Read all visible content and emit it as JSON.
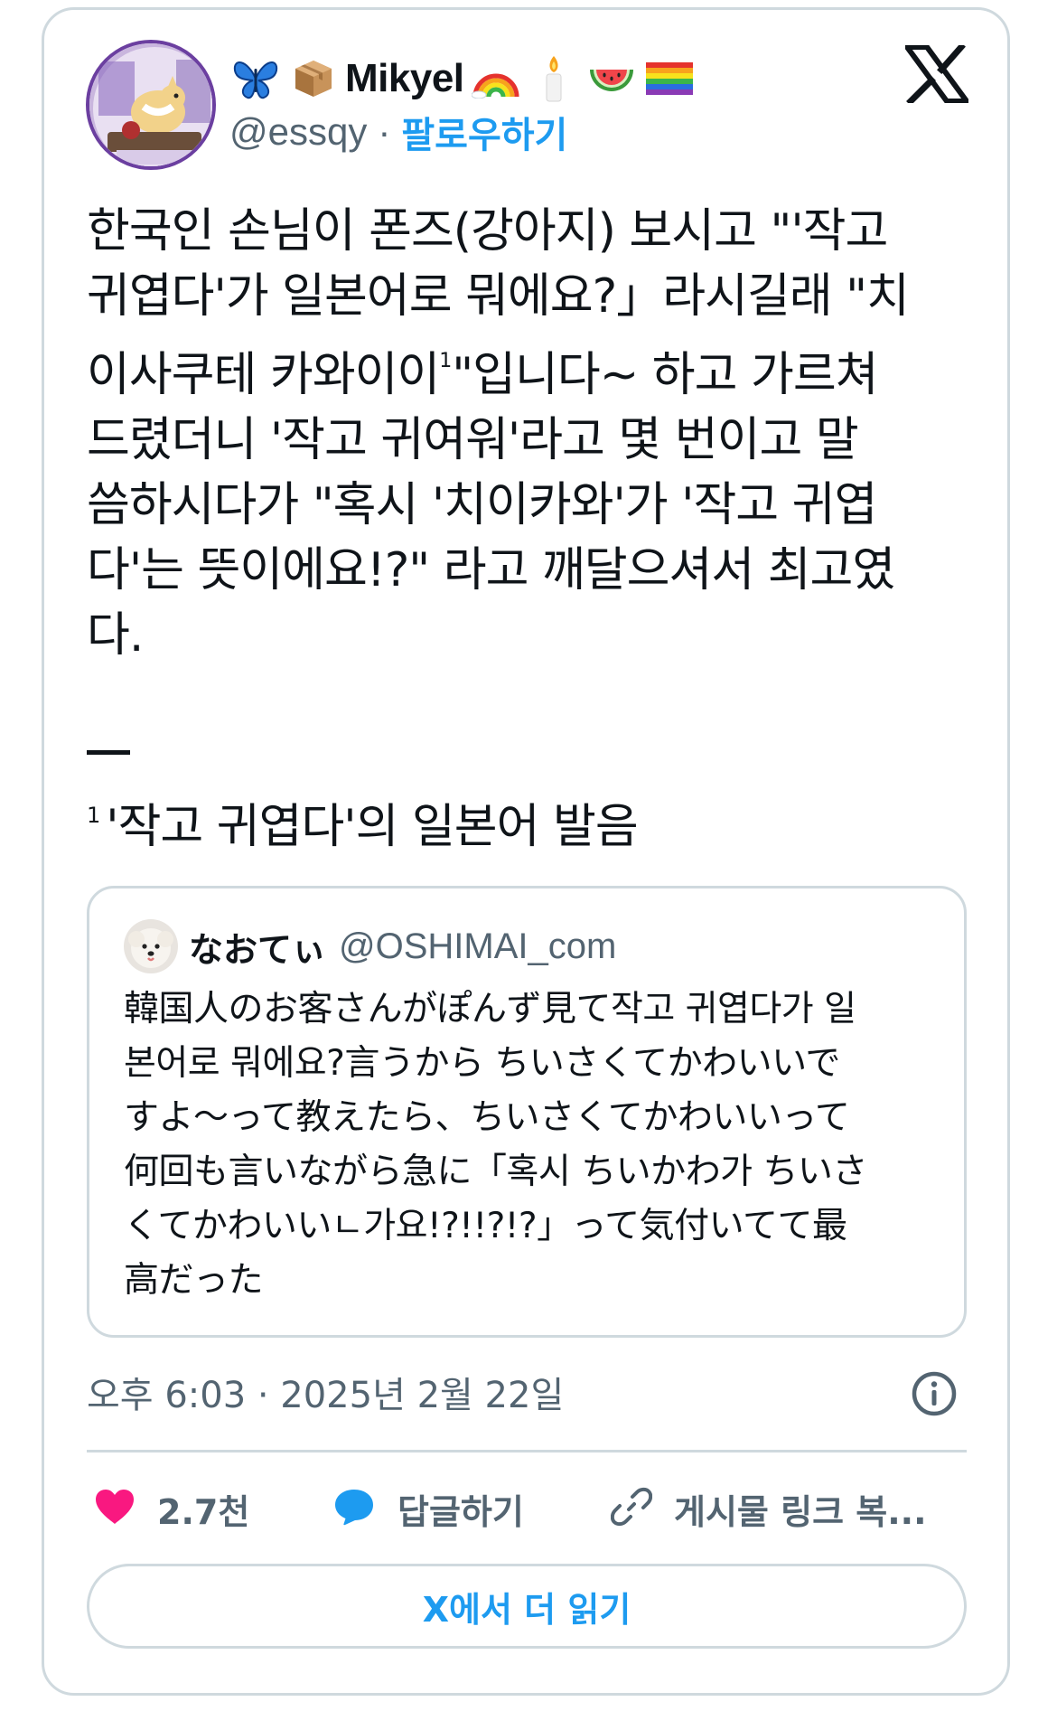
{
  "author": {
    "display_name": "Mikyel",
    "handle": "@essqy",
    "separator": "·",
    "follow_label": "팔로우하기",
    "name_emojis_before": [
      "butterfly-emoji",
      "package-emoji"
    ],
    "name_emojis_after": [
      "rainbow-emoji",
      "candle-emoji",
      "watermelon-emoji",
      "rainbow-flag-emoji"
    ]
  },
  "brand": {
    "logo": "x-logo",
    "color": "#0f1419"
  },
  "tweet": {
    "lines": [
      "한국인 손님이 폰즈(강아지) 보시고 \"'작고",
      "귀엽다'가 일본어로 뭐에요?」라시길래 \"치",
      "이사쿠테 카와이이",
      "드렸더니 '작고 귀여워'라고 몇 번이고 말",
      "씀하시다가 \"혹시 '치이카와'가 '작고 귀엽",
      "다'는 뜻이에요!?\" 라고 깨달으셔서 최고였",
      "다."
    ],
    "line3_sup": "1",
    "line3_rest": "\"입니다~ 하고 가르쳐",
    "footnote_marker": "1",
    "footnote_text": "'작고 귀엽다'의 일본어 발음"
  },
  "quote": {
    "name": "なおてぃ",
    "handle": "@OSHIMAI_com",
    "lines": [
      "韓国人のお客さんがぽんず見て작고 귀엽다가 일",
      "본어로 뭐에요?言うから ちいさくてかわいいで",
      "すよ〜って教えたら、ちいさくてかわいいって",
      "何回も言いながら急に「혹시 ちいかわ가 ちいさ",
      "くてかわいいㄴ가요!?!!?!?」って気付いてて最",
      "高だった"
    ]
  },
  "timestamp": "오후 6:03 · 2025년 2월 22일",
  "actions": {
    "like_count": "2.7천",
    "reply_label": "답글하기",
    "copy_label": "게시물 링크 복..."
  },
  "read_more_label": "X에서 더 읽기",
  "colors": {
    "accent": "#1d9bf0",
    "like": "#f91880",
    "muted": "#536471",
    "border": "#cfd9de"
  }
}
